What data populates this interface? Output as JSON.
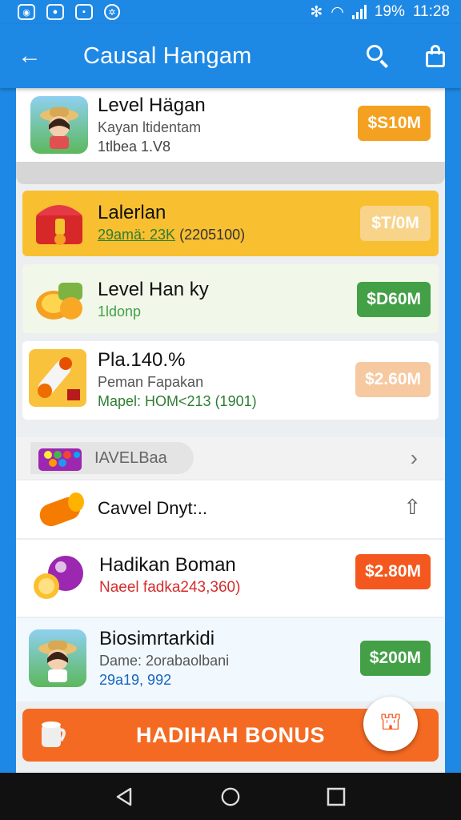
{
  "status_bar": {
    "battery": "19%",
    "time": "11:28"
  },
  "app_bar": {
    "title": "Causal Hangam",
    "back_icon": "arrow-left-icon",
    "search_icon": "search-icon",
    "bag_icon": "shopping-bag-icon"
  },
  "items": [
    {
      "title": "Level Hägan",
      "sub": "Kayan ltidentam",
      "sub2": "1tlbea 1.V8",
      "price": "$S10M",
      "price_color": "#f4a020"
    },
    {
      "title": "Lalerlan",
      "sub_left": "29amä: 23K",
      "sub_right": "(2205100)",
      "price": "$T/0M",
      "price_color": "#f8d48a"
    },
    {
      "title": "Level Han ky",
      "sub": "1ldonp",
      "price": "$D60M",
      "price_color": "#43a047"
    },
    {
      "title": "Pla.140.%",
      "sub": "Peman Fapakan",
      "sub2": "Mapel: HOM<213 (1901)",
      "price": "$2.60M",
      "price_color": "#f6c9a0"
    }
  ],
  "section": {
    "label": "IAVELBaa",
    "chevron_icon": "chevron-right-icon"
  },
  "list": [
    {
      "title": "Cavvel Dnyt:..",
      "action_icon": "share-icon"
    },
    {
      "title": "Hadikan Boman",
      "sub": "Naeel fadka243,360)",
      "price": "$2.80M",
      "price_color": "#f4581e"
    },
    {
      "title": "Biosimrtarkidi",
      "sub": "Dame: 2orabaolbani",
      "sub2": "29a19, 992",
      "price": "$200M",
      "price_color": "#43a047"
    }
  ],
  "bonus": {
    "label": "HADIHAH BONUS"
  }
}
